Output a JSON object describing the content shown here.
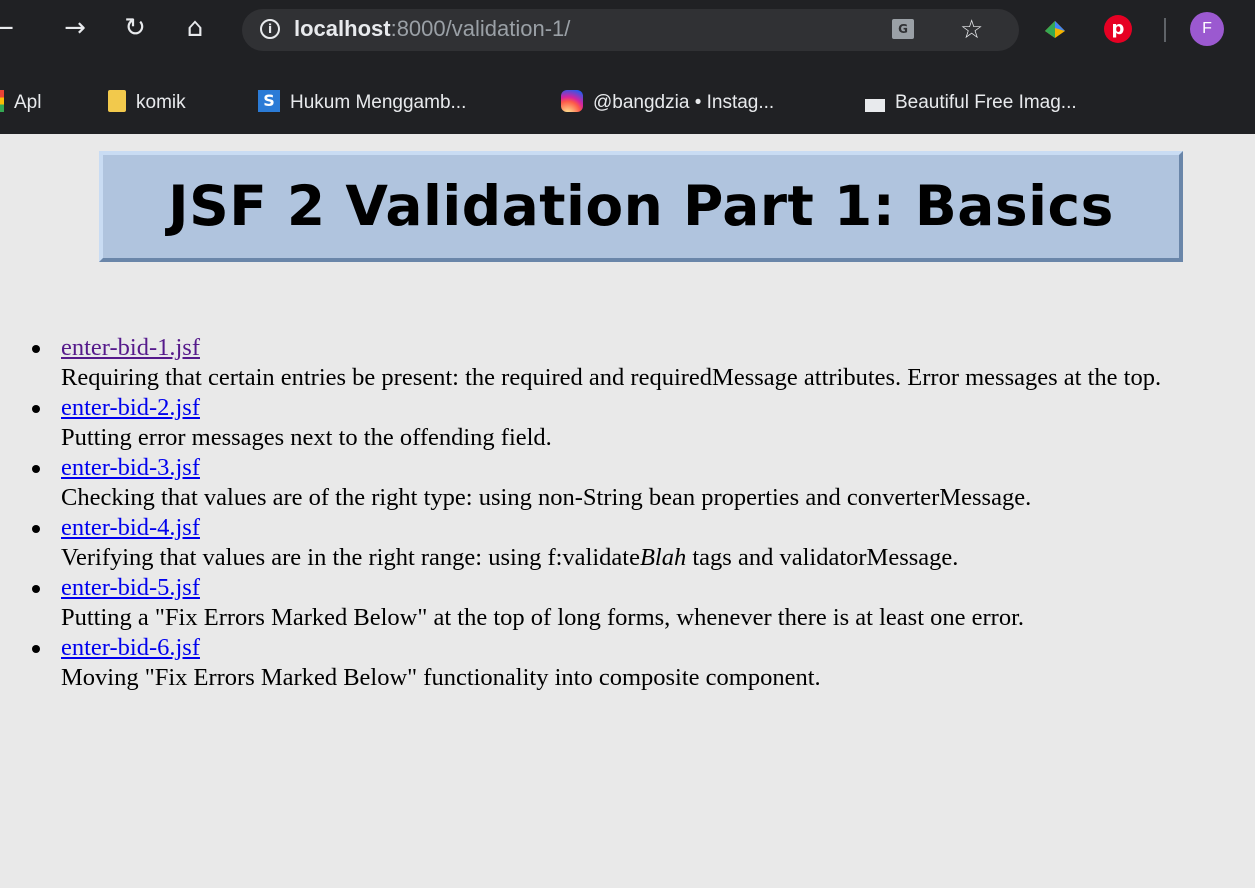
{
  "browser": {
    "url_host": "localhost",
    "url_rest": ":8000/validation-1/",
    "avatar_letter": "F",
    "bookmarks": [
      {
        "label": "Apl",
        "icon": "apps-grid-icon"
      },
      {
        "label": "komik",
        "icon": "folder-icon"
      },
      {
        "label": "Hukum Menggamb...",
        "icon": "site-s-icon"
      },
      {
        "label": "@bangdzia • Instag...",
        "icon": "instagram-icon"
      },
      {
        "label": "Beautiful Free Imag...",
        "icon": "unsplash-icon"
      }
    ]
  },
  "page": {
    "title": "JSF 2 Validation Part 1: Basics",
    "items": [
      {
        "link": "enter-bid-1.jsf",
        "visited": true,
        "desc": "Requiring that certain entries be present: the required and requiredMessage attributes. Error messages at the top."
      },
      {
        "link": "enter-bid-2.jsf",
        "visited": false,
        "desc": "Putting error messages next to the offending field."
      },
      {
        "link": "enter-bid-3.jsf",
        "visited": false,
        "desc": "Checking that values are of the right type: using non-String bean properties and converterMessage."
      },
      {
        "link": "enter-bid-4.jsf",
        "visited": false,
        "desc_pre": "Verifying that values are in the right range: using f:validate",
        "desc_em": "Blah",
        "desc_post": " tags and validatorMessage."
      },
      {
        "link": "enter-bid-5.jsf",
        "visited": false,
        "desc": "Putting a \"Fix Errors Marked Below\" at the top of long forms, whenever there is at least one error."
      },
      {
        "link": "enter-bid-6.jsf",
        "visited": false,
        "desc": "Moving \"Fix Errors Marked Below\" functionality into composite component."
      }
    ]
  }
}
